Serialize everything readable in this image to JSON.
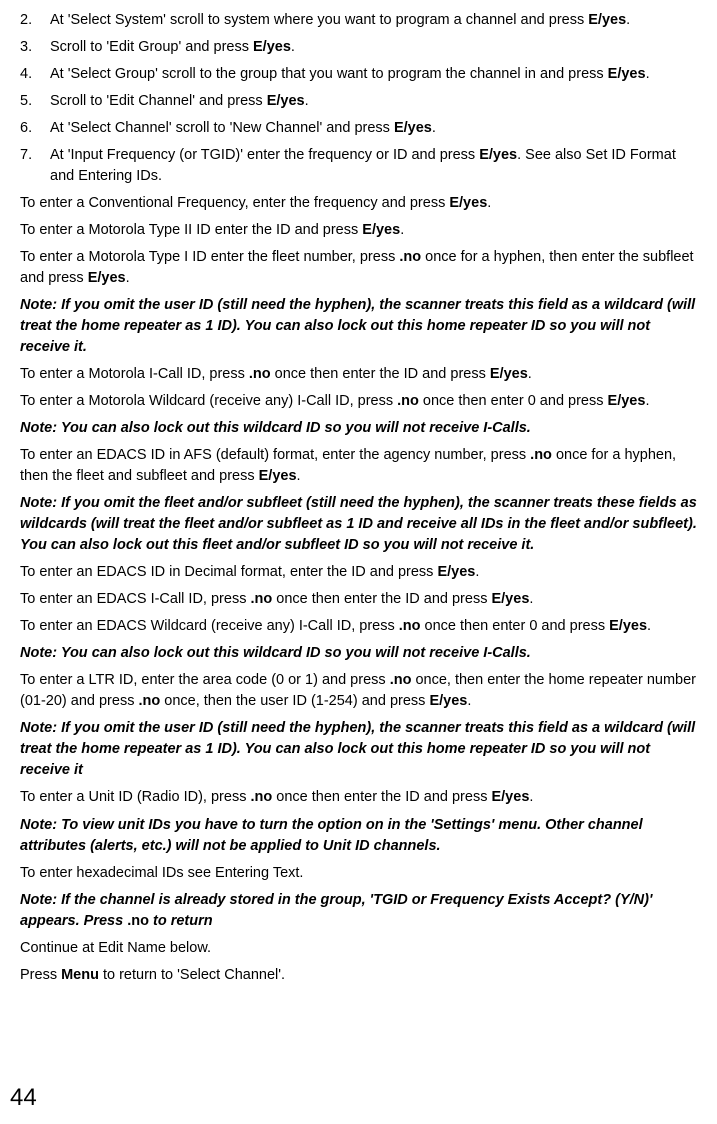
{
  "steps": [
    {
      "n": "2.",
      "pre": "At 'Select System' scroll to system where you want to program a channel and press ",
      "bold": "E/yes",
      "post": "."
    },
    {
      "n": "3.",
      "pre": "Scroll to 'Edit Group' and press ",
      "bold": "E/yes",
      "post": "."
    },
    {
      "n": "4.",
      "pre": "At 'Select Group' scroll to the group that you want to program the channel in and press ",
      "bold": "E/yes",
      "post": "."
    },
    {
      "n": "5.",
      "pre": "Scroll to 'Edit Channel' and press ",
      "bold": "E/yes",
      "post": "."
    },
    {
      "n": "6.",
      "pre": "At 'Select Channel' scroll to 'New Channel' and press ",
      "bold": "E/yes",
      "post": "."
    },
    {
      "n": "7.",
      "pre": "At 'Input Frequency (or TGID)' enter the frequency or ID and press ",
      "bold": "E/yes",
      "post": ". See also Set ID Format and Entering IDs."
    }
  ],
  "p1": {
    "a": "To enter a Conventional Frequency, enter the frequency and press ",
    "b": "E/yes",
    "c": "."
  },
  "p2": {
    "a": "To enter a Motorola Type II ID enter the ID and press ",
    "b": "E/yes",
    "c": "."
  },
  "p3": {
    "a": "To enter a Motorola Type I ID enter the fleet number, press ",
    "b": ".no",
    "c": " once for a hyphen, then enter the subfleet and press ",
    "d": "E/yes",
    "e": "."
  },
  "n1": "Note: If you omit the user ID (still need the hyphen), the scanner treats this field as a wildcard (will treat the home repeater as 1 ID). You can also lock out this home repeater ID so you will not receive it.",
  "p4": {
    "a": "To enter a Motorola I-Call ID, press ",
    "b": ".no",
    "c": " once then enter the ID and press ",
    "d": "E/yes",
    "e": "."
  },
  "p5": {
    "a": "To enter a Motorola Wildcard (receive any) I-Call ID, press ",
    "b": ".no",
    "c": " once then enter 0 and press ",
    "d": "E/yes",
    "e": "."
  },
  "n2": "Note: You can also lock out this wildcard ID so you will not receive I-Calls.",
  "p6": {
    "a": "To enter an EDACS ID in AFS (default) format, enter the agency number, press ",
    "b": ".no",
    "c": " once for a hyphen, then the fleet and subfleet and press ",
    "d": "E/yes",
    "e": "."
  },
  "n3": "Note: If you omit the fleet and/or subfleet (still need the hyphen), the scanner treats these fields as wildcards (will treat the fleet and/or subfleet as 1 ID and receive all IDs in the fleet and/or subfleet). You can also lock out this fleet and/or subfleet ID so you will not receive it.",
  "p7": {
    "a": "To enter an EDACS ID in Decimal format, enter the ID and press ",
    "b": "E/yes",
    "c": "."
  },
  "p8": {
    "a": "To enter an EDACS I-Call ID, press ",
    "b": ".no",
    "c": " once then enter the ID and press ",
    "d": "E/yes",
    "e": "."
  },
  "p9": {
    "a": "To enter an EDACS Wildcard (receive any) I-Call ID, press ",
    "b": ".no",
    "c": " once then enter 0 and press ",
    "d": "E/yes",
    "e": "."
  },
  "n4": "Note: You can also lock out this wildcard ID so you will not receive I-Calls.",
  "p10": {
    "a": "To enter a LTR ID, enter the area code (0 or 1) and press ",
    "b": ".no",
    "c": " once, then enter the home repeater number (01-20) and press ",
    "d": ".no",
    "e": " once, then the user ID (1-254) and press ",
    "f": "E/yes",
    "g": "."
  },
  "n5": "Note: If you omit the user ID (still need the hyphen), the scanner treats this field as a wildcard (will treat the home repeater as 1 ID). You can also lock out this home repeater ID so you will not receive it",
  "p11": {
    "a": "To enter a Unit ID (Radio ID), press ",
    "b": ".no",
    "c": " once then enter the ID and press ",
    "d": "E/yes",
    "e": "."
  },
  "n6": "Note: To view unit IDs you have to turn the option on in the 'Settings' menu. Other channel attributes (alerts, etc.) will not be applied to Unit ID channels.",
  "p12": "To enter hexadecimal IDs see Entering Text.",
  "n7": {
    "a": "Note: If the channel is already stored in the group, 'TGID or Frequency Exists Accept? (Y/N)' appears. Press ",
    "b": ".no",
    "c": " to return"
  },
  "p13": "Continue at Edit Name below.",
  "p14": {
    "a": "Press ",
    "b": "Menu",
    "c": " to return to 'Select Channel'."
  },
  "page": "44"
}
